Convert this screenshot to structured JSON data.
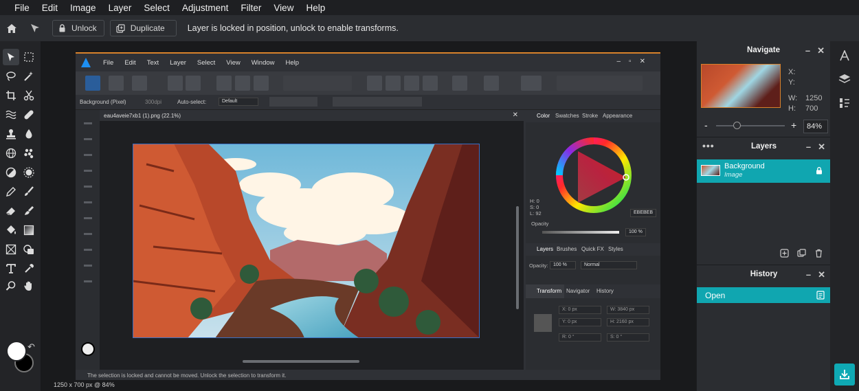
{
  "menu": [
    "File",
    "Edit",
    "Image",
    "Layer",
    "Select",
    "Adjustment",
    "Filter",
    "View",
    "Help"
  ],
  "toolbar": {
    "unlock_label": "Unlock",
    "duplicate_label": "Duplicate",
    "message": "Layer is locked in position, unlock to enable transforms."
  },
  "status_text": "1250 x 700 px @ 84%",
  "navigate": {
    "title": "Navigate",
    "x_label": "X:",
    "y_label": "Y:",
    "w_label": "W:",
    "w_value": "1250",
    "h_label": "H:",
    "h_value": "700",
    "zoom_minus": "-",
    "zoom_plus": "+",
    "zoom_value": "84%"
  },
  "layers_panel": {
    "title": "Layers",
    "layer_name": "Background",
    "layer_type": "Image"
  },
  "history_panel": {
    "title": "History",
    "entry": "Open"
  },
  "inner_app": {
    "menu": [
      "File",
      "Edit",
      "Text",
      "Layer",
      "Select",
      "View",
      "Window",
      "Help"
    ],
    "ctx_layer": "Background (Pixel)",
    "ctx_dpi": "300dpi",
    "ctx_autoselect": "Auto-select:",
    "ctx_default": "Default",
    "doc_tab": "eau4aveie7xb1 (1).png (22.1%)",
    "color_tabs": [
      "Color",
      "Swatches",
      "Stroke",
      "Appearance"
    ],
    "hsl": [
      "H: 0",
      "S: 0",
      "L: 92"
    ],
    "hex": "EBEBEB",
    "opacity_label": "Opacity",
    "opacity_value": "100 %",
    "layer_tabs": [
      "Layers",
      "Brushes",
      "Quick FX",
      "Styles"
    ],
    "layer_opacity_label": "Opacity:",
    "layer_opacity_value": "100 %",
    "blend_mode": "Normal",
    "transform_tabs": [
      "Transform",
      "Navigator",
      "History"
    ],
    "tf_x": "X: 0 px",
    "tf_y": "Y: 0 px",
    "tf_w": "W: 3840 px",
    "tf_h": "H: 2160 px",
    "tf_r": "R: 0 °",
    "tf_s": "S: 0 °",
    "bottom_msg": "The selection is locked and cannot be moved. Unlock the selection to transform it."
  },
  "colors": {
    "accent": "#10a6b0",
    "menu_bg": "#1e1f22",
    "panel_bg": "#2b2d31"
  }
}
